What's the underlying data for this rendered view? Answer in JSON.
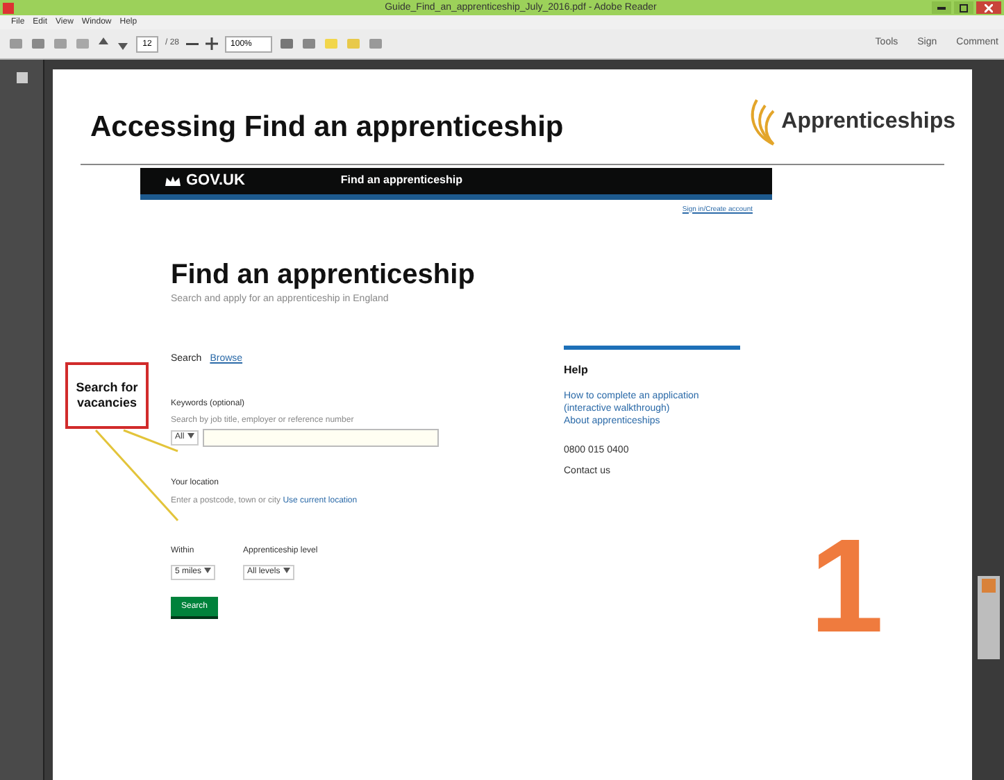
{
  "window": {
    "title": "Guide_Find_an_apprenticeship_July_2016.pdf - Adobe Reader"
  },
  "menu": [
    "File",
    "Edit",
    "View",
    "Window",
    "Help"
  ],
  "toolbar": {
    "page": "12",
    "page_count": "/ 28",
    "zoom": "100%",
    "panes": [
      "Tools",
      "Sign",
      "Comment"
    ]
  },
  "document": {
    "heading": "Accessing Find an apprenticeship",
    "logo": "Apprenticeships",
    "step_number": "1",
    "callout": "Search for vacancies",
    "site": {
      "brand": "GOV.UK",
      "service": "Find an apprenticeship",
      "account_link": "Sign in/Create account",
      "title": "Find an apprenticeship",
      "subtitle": "Search and apply for an apprenticeship in England",
      "tabs": [
        {
          "label": "Search",
          "selected": true
        },
        {
          "label": "Browse",
          "selected": false
        }
      ],
      "keywords_label": "Keywords (optional)",
      "keywords_hint": "Search by job title, employer or reference number",
      "keywords_scope": "All",
      "location_label": "Your location",
      "location_hint": "Enter a postcode, town or city",
      "location_link": "Use current location",
      "within_label": "Within",
      "within_value": "5 miles",
      "level_label": "Apprenticeship level",
      "level_value": "All levels",
      "search_button": "Search",
      "help": {
        "title": "Help",
        "links": [
          "How to complete an application",
          "(interactive walkthrough)",
          "About apprenticeships"
        ],
        "phone": "0800 015 0400",
        "contact": "Contact us"
      }
    }
  }
}
